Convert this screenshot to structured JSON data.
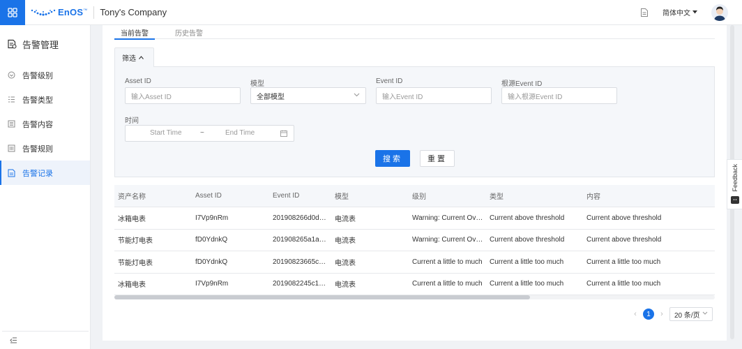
{
  "header": {
    "brand": "EnOS",
    "brand_tm": "™",
    "company": "Tony's Company",
    "language": "简体中文"
  },
  "sidebar": {
    "title": "告警管理",
    "items": [
      {
        "label": "告警级别",
        "icon": "level-icon"
      },
      {
        "label": "告警类型",
        "icon": "type-icon"
      },
      {
        "label": "告警内容",
        "icon": "content-icon"
      },
      {
        "label": "告警规则",
        "icon": "rule-icon"
      },
      {
        "label": "告警记录",
        "icon": "record-icon",
        "active": true
      }
    ]
  },
  "tabs": [
    {
      "label": "当前告警",
      "active": true
    },
    {
      "label": "历史告警"
    }
  ],
  "filter": {
    "toggle_label": "筛选",
    "asset_id": {
      "label": "Asset ID",
      "placeholder": "输入Asset ID"
    },
    "model": {
      "label": "模型",
      "value": "全部模型"
    },
    "event_id": {
      "label": "Event ID",
      "placeholder": "输入Event ID"
    },
    "root_event_id": {
      "label": "根源Event ID",
      "placeholder": "输入根源Event ID"
    },
    "time": {
      "label": "时间",
      "start": "Start Time",
      "separator": "~",
      "end": "End Time"
    },
    "search_label": "搜索",
    "reset_label": "重置"
  },
  "table": {
    "columns": [
      "资产名称",
      "Asset ID",
      "Event ID",
      "模型",
      "级别",
      "类型",
      "内容"
    ],
    "rows": [
      [
        "冰箱电表",
        "I7Vp9nRm",
        "201908266d0d…",
        "电流表",
        "Warning: Current Ov…",
        "Current above threshold",
        "Current above threshold"
      ],
      [
        "节能灯电表",
        "fD0YdnkQ",
        "201908265a1a…",
        "电流表",
        "Warning: Current Ov…",
        "Current above threshold",
        "Current above threshold"
      ],
      [
        "节能灯电表",
        "fD0YdnkQ",
        "20190823665c…",
        "电流表",
        "Current a little to much",
        "Current a little too much",
        "Current a little too much"
      ],
      [
        "冰箱电表",
        "I7Vp9nRm",
        "2019082245c1…",
        "电流表",
        "Current a little to much",
        "Current a little too much",
        "Current a little too much"
      ]
    ]
  },
  "pagination": {
    "current_page": "1",
    "page_size": "20 条/页"
  },
  "feedback_label": "Feedback",
  "colors": {
    "primary": "#1a73e8",
    "panel_bg": "#f5f7fa"
  }
}
